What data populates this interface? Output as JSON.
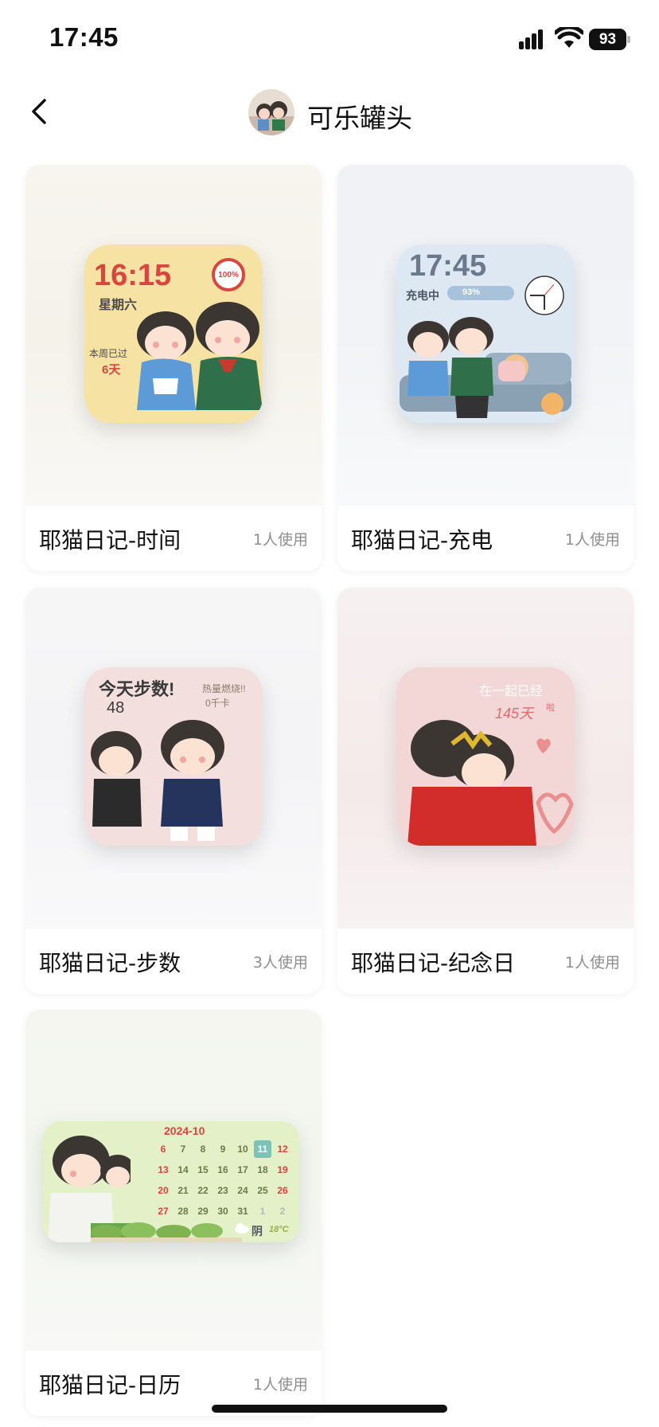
{
  "status_bar": {
    "time": "17:45",
    "battery": "93"
  },
  "header": {
    "title": "可乐罐头"
  },
  "cards": [
    {
      "name": "耶猫日记-时间",
      "usage": "1人使用",
      "widget": {
        "time": "16:15",
        "weekday": "星期六",
        "battery": "100%",
        "week_text": "本周已过",
        "days": "6天"
      }
    },
    {
      "name": "耶猫日记-充电",
      "usage": "1人使用",
      "widget": {
        "time": "17:45",
        "charging": "充电中",
        "battery": "93%"
      }
    },
    {
      "name": "耶猫日记-步数",
      "usage": "3人使用",
      "widget": {
        "steps_label": "今天步数!",
        "steps": "48",
        "calorie_label": "热量燃烧!!",
        "calories": "0千卡"
      }
    },
    {
      "name": "耶猫日记-纪念日",
      "usage": "1人使用",
      "widget": {
        "together": "在一起已经",
        "days": "145天",
        "suffix": "啦"
      }
    },
    {
      "name": "耶猫日记-日历",
      "usage": "1人使用",
      "widget": {
        "month": "2024-10",
        "rows": [
          [
            "6",
            "7",
            "8",
            "9",
            "10",
            "11",
            "12"
          ],
          [
            "13",
            "14",
            "15",
            "16",
            "17",
            "18",
            "19"
          ],
          [
            "20",
            "21",
            "22",
            "23",
            "24",
            "25",
            "26"
          ],
          [
            "27",
            "28",
            "29",
            "30",
            "31",
            "1",
            "2"
          ]
        ],
        "weather": "阴",
        "temp": "18°C"
      }
    }
  ],
  "colors": {
    "accent_red": "#d9453f",
    "widget_yellow": "#f6e3a4",
    "widget_blue": "#dde8f3",
    "widget_pink": "#f3dcdc",
    "widget_green": "#e4f0c8"
  }
}
